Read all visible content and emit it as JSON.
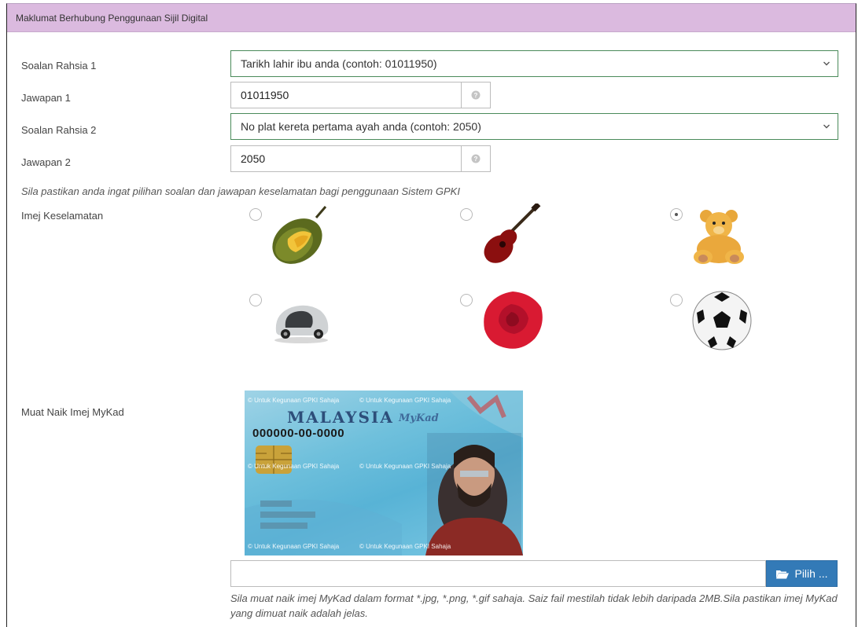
{
  "panel": {
    "title": "Maklumat Berhubung Penggunaan Sijil Digital"
  },
  "q1": {
    "label": "Soalan Rahsia 1",
    "selected": "Tarikh lahir ibu anda (contoh: 01011950)"
  },
  "a1": {
    "label": "Jawapan 1",
    "value": "01011950"
  },
  "q2": {
    "label": "Soalan Rahsia 2",
    "selected": "No plat kereta pertama ayah anda (contoh: 2050)"
  },
  "a2": {
    "label": "Jawapan 2",
    "value": "2050"
  },
  "note": "Sila pastikan anda ingat pilihan soalan dan jawapan keselamatan bagi penggunaan Sistem GPKI",
  "security_image": {
    "label": "Imej Keselamatan",
    "options": [
      {
        "name": "durian",
        "checked": false
      },
      {
        "name": "guitar",
        "checked": false
      },
      {
        "name": "teddy-bear",
        "checked": true
      },
      {
        "name": "car",
        "checked": false
      },
      {
        "name": "rose",
        "checked": false
      },
      {
        "name": "soccer-ball",
        "checked": false
      }
    ]
  },
  "mykad": {
    "label": "Muat Naik Imej MyKad",
    "country": "MALAYSIA",
    "brand": "MyKad",
    "ic_number": "000000-00-0000",
    "watermark": "© Untuk Kegunaan GPKI Sahaja"
  },
  "upload": {
    "button_label": "Pilih ...",
    "help": "Sila muat naik imej MyKad dalam format *.jpg, *.png, *.gif sahaja. Saiz fail mestilah tidak lebih daripada 2MB.Sila pastikan imej MyKad yang dimuat naik adalah jelas."
  },
  "colors": {
    "header_bg": "#dbbadf",
    "select_border": "#4a8a5a",
    "button_bg": "#337ab7"
  }
}
